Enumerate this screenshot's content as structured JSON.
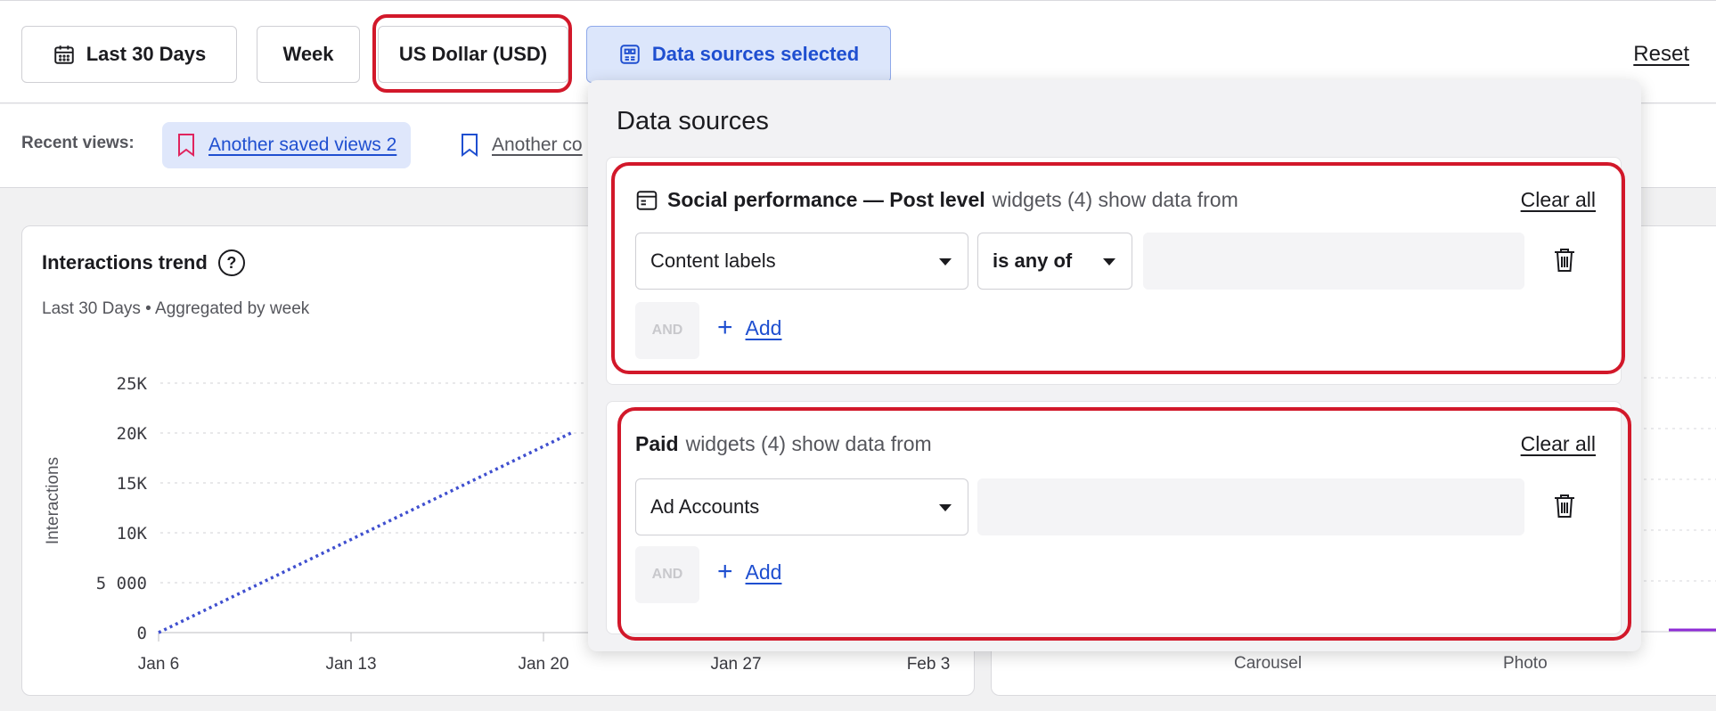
{
  "toolbar": {
    "date_range_label": "Last 30 Days",
    "granularity_label": "Week",
    "currency_label": "US Dollar (USD)",
    "data_sources_label": "Data sources selected",
    "reset_label": "Reset"
  },
  "recent_views": {
    "label": "Recent views:",
    "items": [
      {
        "label": "Another saved views 2"
      },
      {
        "label": "Another co"
      }
    ]
  },
  "interactions_card": {
    "title": "Interactions trend",
    "help_glyph": "?",
    "subtitle": "Last 30 Days • Aggregated by week"
  },
  "chart_data": {
    "type": "line",
    "title": "Interactions trend",
    "ylabel": "Interactions",
    "xlabel": "",
    "x_ticks": [
      "Jan 6",
      "Jan 13",
      "Jan 20",
      "Jan 27",
      "Feb 3"
    ],
    "y_ticks": [
      "0",
      "5 000",
      "10K",
      "15K",
      "20K",
      "25K"
    ],
    "ylim": [
      0,
      25000
    ],
    "grid": true,
    "series": [
      {
        "points": [
          [
            "Jan 6",
            0
          ],
          [
            "Jan 21",
            20000
          ]
        ],
        "style": "dotted",
        "color": "#3f4fcf"
      }
    ]
  },
  "right_card": {
    "x_labels": [
      "Carousel",
      "Photo"
    ]
  },
  "data_sources_panel": {
    "title": "Data sources",
    "sections": [
      {
        "name": "Social performance — Post level",
        "suffix": "widgets (4) show data from",
        "clear_label": "Clear all",
        "field": "Content labels",
        "operator": "is any of",
        "and_label": "AND",
        "add_label": "Add"
      },
      {
        "name": "Paid",
        "suffix": "widgets (4) show data from",
        "clear_label": "Clear all",
        "field": "Ad Accounts",
        "and_label": "AND",
        "add_label": "Add"
      }
    ]
  },
  "colors": {
    "accent": "#1f4fd0",
    "highlight": "#d2182a",
    "line_series": "#3f4fcf",
    "bookmark_active": "#e0245e"
  }
}
